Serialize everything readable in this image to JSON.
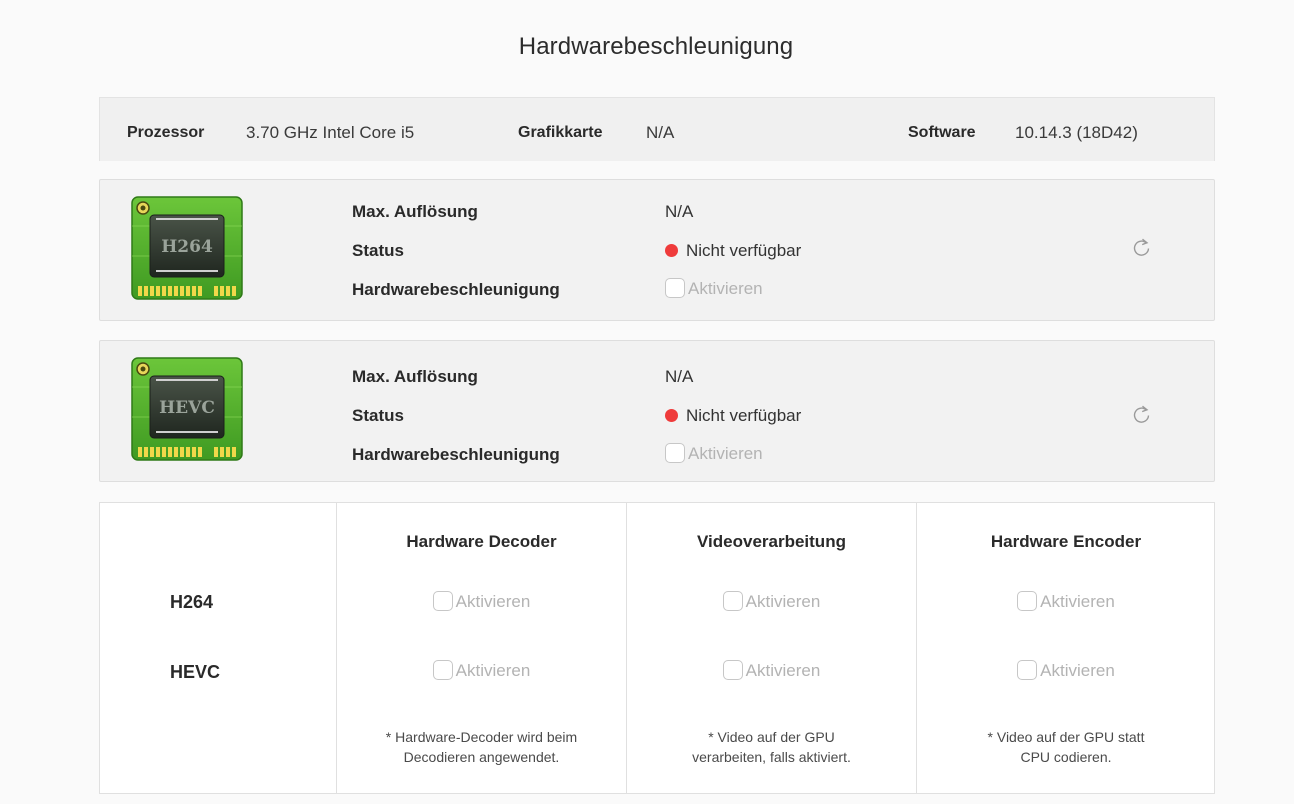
{
  "title": "Hardwarebeschleunigung",
  "system": {
    "processor_label": "Prozessor",
    "processor_value": "3.70 GHz Intel Core i5",
    "gpu_label": "Grafikkarte",
    "gpu_value": "N/A",
    "software_label": "Software",
    "software_value": "10.14.3 (18D42)"
  },
  "codecs": [
    {
      "chip_label": "H264",
      "max_res_label": "Max. Auflösung",
      "max_res_value": "N/A",
      "status_label": "Status",
      "status_value": "Nicht verfügbar",
      "accel_label": "Hardwarebeschleunigung",
      "accel_checkbox": "Aktivieren"
    },
    {
      "chip_label": "HEVC",
      "max_res_label": "Max. Auflösung",
      "max_res_value": "N/A",
      "status_label": "Status",
      "status_value": "Nicht verfügbar",
      "accel_label": "Hardwarebeschleunigung",
      "accel_checkbox": "Aktivieren"
    }
  ],
  "matrix": {
    "columns": [
      "Hardware Decoder",
      "Videoverarbeitung",
      "Hardware Encoder"
    ],
    "rows": [
      "H264",
      "HEVC"
    ],
    "checkbox_label": "Aktivieren",
    "notes": [
      [
        "* Hardware-Decoder wird beim",
        "Decodieren angewendet."
      ],
      [
        "* Video auf der GPU",
        "verarbeiten, falls aktiviert."
      ],
      [
        "* Video auf der GPU statt",
        "CPU codieren."
      ]
    ]
  },
  "colors": {
    "status_dot": "#ef3b3b",
    "chip_board": "#4caf2a",
    "chip_body": "#2f3a2e"
  }
}
